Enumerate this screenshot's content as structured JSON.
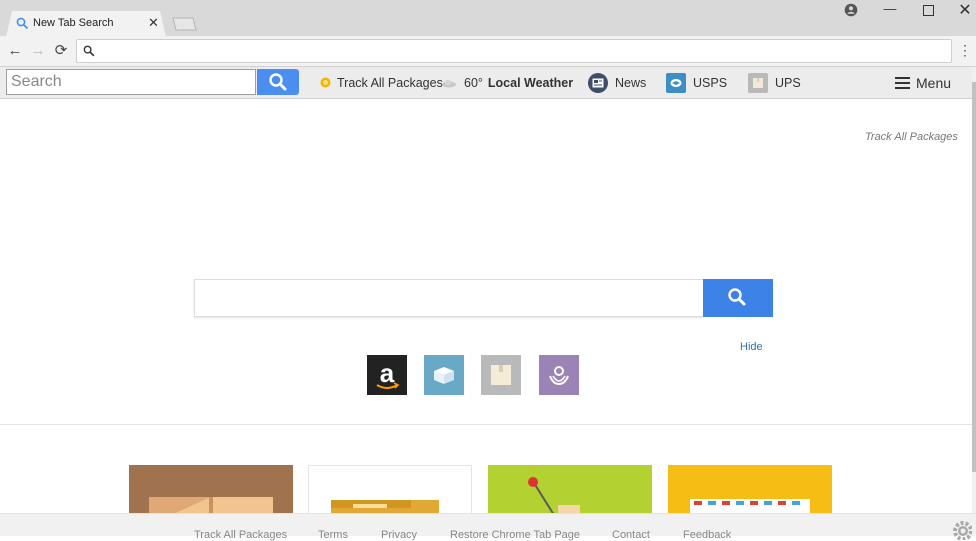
{
  "tab": {
    "title": "New Tab Search",
    "close": "✕"
  },
  "window": {
    "minimize": "—",
    "maximize": "☐",
    "close": "✕"
  },
  "nav": {
    "back": "←",
    "forward": "→",
    "reload": "⟳",
    "menu": "⋮"
  },
  "omnibox": {
    "value": ""
  },
  "extbar": {
    "search_placeholder": "Search",
    "track_label": "Track All Packages",
    "weather_temp": "60°",
    "weather_label": "Local Weather",
    "news_label": "News",
    "usps_label": "USPS",
    "ups_label": "UPS",
    "menu_label": "Menu"
  },
  "page": {
    "track_link": "Track All Packages",
    "hide_label": "Hide",
    "search_value": ""
  },
  "tiles": [
    "amazon-icon",
    "box-icon",
    "package-icon",
    "hands-icon"
  ],
  "footer": {
    "links": [
      "Track All Packages",
      "Terms",
      "Privacy",
      "Restore Chrome Tab Page",
      "Contact",
      "Feedback"
    ]
  },
  "colors": {
    "accent": "#3d82e6",
    "link": "#2f6fb8"
  }
}
